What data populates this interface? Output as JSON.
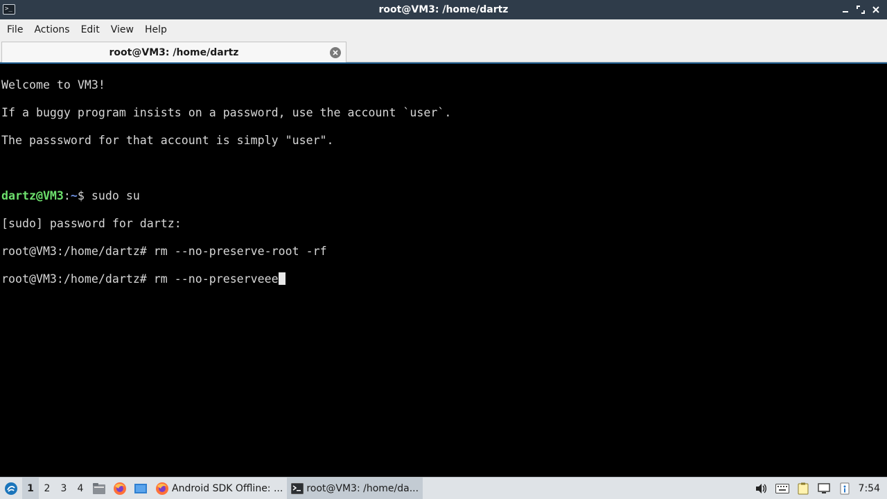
{
  "window": {
    "title": "root@VM3: /home/dartz",
    "app_icon_glyph": ">_"
  },
  "menu": [
    "File",
    "Actions",
    "Edit",
    "View",
    "Help"
  ],
  "tab": {
    "label": "root@VM3: /home/dartz"
  },
  "terminal": {
    "motd": [
      "Welcome to VM3!",
      "If a buggy program insists on a password, use the account `user`.",
      "The passsword for that account is simply \"user\"."
    ],
    "prompt_user": "dartz@VM3",
    "prompt_sep": ":",
    "prompt_path": "~",
    "prompt_suffix": "$ ",
    "command1": "sudo su",
    "sudo_line": "[sudo] password for dartz:",
    "root_prompt": "root@VM3:/home/dartz# ",
    "command2": "rm --no-preserve-root -rf",
    "command3": "rm --no-preserveee"
  },
  "taskbar": {
    "workspaces": [
      "1",
      "2",
      "3",
      "4"
    ],
    "active_workspace": "1",
    "tasks": [
      {
        "label": "Android SDK Offline: ...",
        "icon": "firefox-icon"
      },
      {
        "label": "root@VM3: /home/da...",
        "icon": "terminal-icon"
      }
    ],
    "clock": "7:54"
  },
  "colors": {
    "titlebar": "#2f3c4a",
    "terminal_bg": "#000000",
    "prompt_user": "#6de06d",
    "prompt_path": "#6d8fe0",
    "accent": "#1f5d8f"
  }
}
